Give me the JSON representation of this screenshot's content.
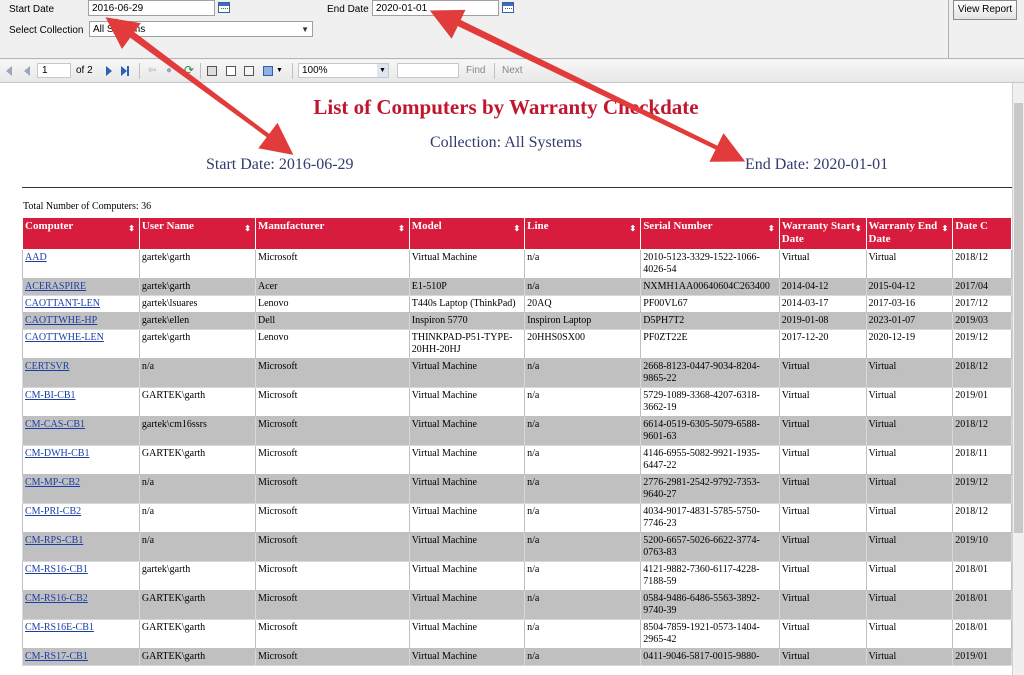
{
  "params": {
    "start_label": "Start Date",
    "start_value": "2016-06-29",
    "end_label": "End Date",
    "end_value": "2020-01-01",
    "collection_label": "Select Collection",
    "collection_value": "All Systems",
    "view_report": "View Report"
  },
  "toolbar": {
    "page": "1",
    "of_pages": "of 2",
    "zoom": "100%",
    "find": "Find",
    "next": "Next"
  },
  "report": {
    "title": "List of Computers by Warranty Checkdate",
    "collection": "Collection: All Systems",
    "start": "Start Date: 2016-06-29",
    "end": "End Date: 2020-01-01",
    "total": "Total Number of Computers: 36"
  },
  "table": {
    "headers": [
      "Computer",
      "User Name",
      "Manufacturer",
      "Model",
      "Line",
      "Serial Number",
      "Warranty Start Date",
      "Warranty End Date",
      "Date C"
    ],
    "rows": [
      [
        "AAD",
        "gartek\\garth",
        "Microsoft",
        "Virtual Machine",
        "n/a",
        "2010-5123-3329-1522-1066-4026-54",
        "Virtual",
        "Virtual",
        "2018/12"
      ],
      [
        "ACERASPIRE",
        "gartek\\garth",
        "Acer",
        "E1-510P",
        "n/a",
        "NXMH1AA00640604C263400",
        "2014-04-12",
        "2015-04-12",
        "2017/04"
      ],
      [
        "CAOTTANT-LEN",
        "gartek\\lsuares",
        "Lenovo",
        "T440s Laptop (ThinkPad)",
        "20AQ",
        "PF00VL67",
        "2014-03-17",
        "2017-03-16",
        "2017/12"
      ],
      [
        "CAOTTWHE-HP",
        "gartek\\ellen",
        "Dell",
        "Inspiron 5770",
        "Inspiron Laptop",
        "D5PH7T2",
        "2019-01-08",
        "2023-01-07",
        "2019/03"
      ],
      [
        "CAOTTWHE-LEN",
        "gartek\\garth",
        "Lenovo",
        "THINKPAD-P51-TYPE-20HH-20HJ",
        "20HHS0SX00",
        "PF0ZT22E",
        "2017-12-20",
        "2020-12-19",
        "2019/12"
      ],
      [
        "CERTSVR",
        "n/a",
        "Microsoft",
        "Virtual Machine",
        "n/a",
        "2668-8123-0447-9034-8204-9865-22",
        "Virtual",
        "Virtual",
        "2018/12"
      ],
      [
        "CM-BI-CB1",
        "GARTEK\\garth",
        "Microsoft",
        "Virtual Machine",
        "n/a",
        "5729-1089-3368-4207-6318-3662-19",
        "Virtual",
        "Virtual",
        "2019/01"
      ],
      [
        "CM-CAS-CB1",
        "gartek\\cm16ssrs",
        "Microsoft",
        "Virtual Machine",
        "n/a",
        "6614-0519-6305-5079-6588-9601-63",
        "Virtual",
        "Virtual",
        "2018/12"
      ],
      [
        "CM-DWH-CB1",
        "GARTEK\\garth",
        "Microsoft",
        "Virtual Machine",
        "n/a",
        "4146-6955-5082-9921-1935-6447-22",
        "Virtual",
        "Virtual",
        "2018/11"
      ],
      [
        "CM-MP-CB2",
        "n/a",
        "Microsoft",
        "Virtual Machine",
        "n/a",
        "2776-2981-2542-9792-7353-9640-27",
        "Virtual",
        "Virtual",
        "2019/12"
      ],
      [
        "CM-PRI-CB2",
        "n/a",
        "Microsoft",
        "Virtual Machine",
        "n/a",
        "4034-9017-4831-5785-5750-7746-23",
        "Virtual",
        "Virtual",
        "2018/12"
      ],
      [
        "CM-RPS-CB1",
        "n/a",
        "Microsoft",
        "Virtual Machine",
        "n/a",
        "5200-6657-5026-6622-3774-0763-83",
        "Virtual",
        "Virtual",
        "2019/10"
      ],
      [
        "CM-RS16-CB1",
        "gartek\\garth",
        "Microsoft",
        "Virtual Machine",
        "n/a",
        "4121-9882-7360-6117-4228-7188-59",
        "Virtual",
        "Virtual",
        "2018/01"
      ],
      [
        "CM-RS16-CB2",
        "GARTEK\\garth",
        "Microsoft",
        "Virtual Machine",
        "n/a",
        "0584-9486-6486-5563-3892-9740-39",
        "Virtual",
        "Virtual",
        "2018/01"
      ],
      [
        "CM-RS16E-CB1",
        "GARTEK\\garth",
        "Microsoft",
        "Virtual Machine",
        "n/a",
        "8504-7859-1921-0573-1404-2965-42",
        "Virtual",
        "Virtual",
        "2018/01"
      ],
      [
        "CM-RS17-CB1",
        "GARTEK\\garth",
        "Microsoft",
        "Virtual Machine",
        "n/a",
        "0411-9046-5817-0015-9880-",
        "Virtual",
        "Virtual",
        "2019/01"
      ]
    ]
  },
  "colors": {
    "header_red": "#d71c3d",
    "title_red": "#c0172f",
    "arrow_red": "#e23b3b",
    "link_blue": "#1a3da6"
  }
}
